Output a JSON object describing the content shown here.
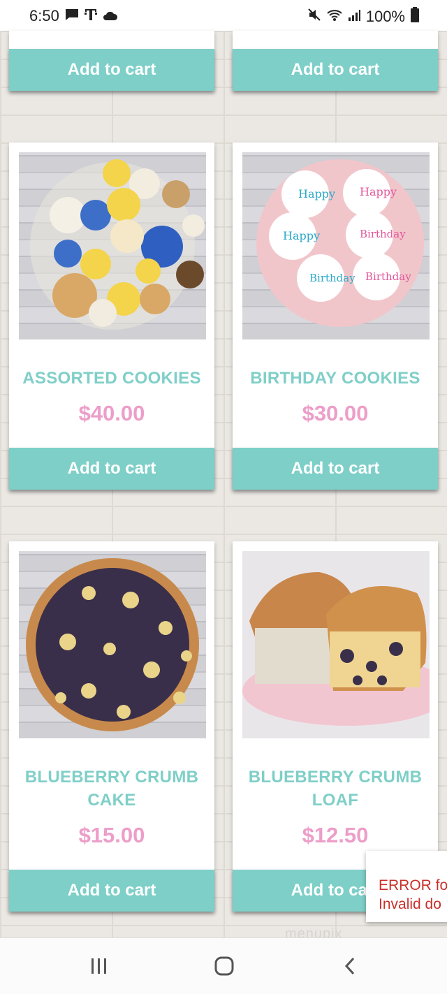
{
  "status_bar": {
    "time": "6:50",
    "battery": "100%"
  },
  "products": [
    {
      "name": "ASSORTED COOKIES",
      "price": "$40.00"
    },
    {
      "name": "BIRTHDAY COOKIES",
      "price": "$30.00"
    },
    {
      "name": "BLUEBERRY CRUMB CAKE",
      "price": "$15.00"
    },
    {
      "name": "BLUEBERRY CRUMB LOAF",
      "price": "$12.50"
    }
  ],
  "cart_button_label": "Add to cart",
  "error_toast": {
    "line1": "ERROR fo",
    "line2": "Invalid do"
  },
  "watermark": "menupix",
  "colors": {
    "accent": "#7dcfc8",
    "price": "#ec9ec9",
    "error": "#c9302c"
  }
}
